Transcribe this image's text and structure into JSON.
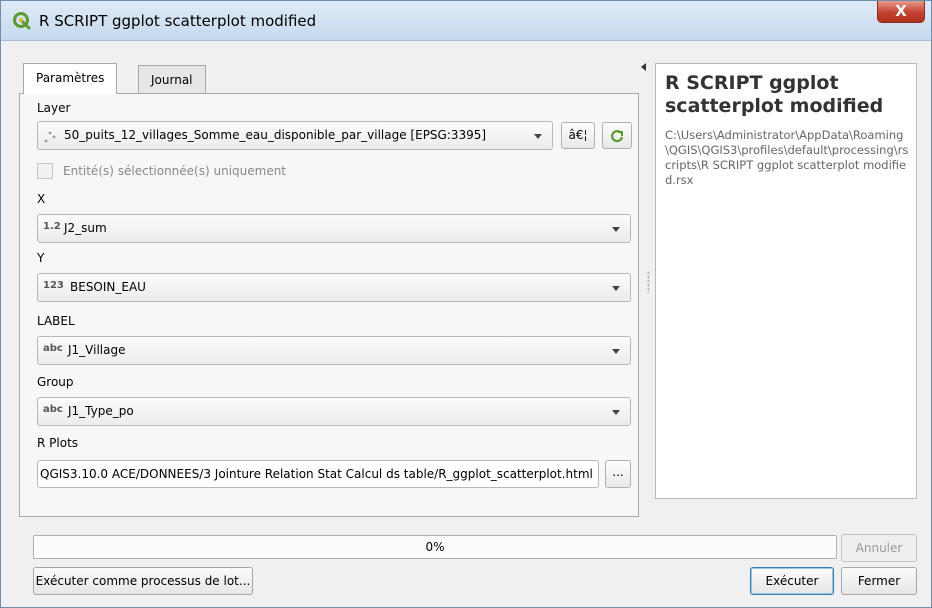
{
  "window": {
    "title": "R SCRIPT ggplot scatterplot modified",
    "close_glyph": "X"
  },
  "tabs": [
    {
      "label": "Paramètres",
      "active": true
    },
    {
      "label": "Journal",
      "active": false
    }
  ],
  "params": {
    "layer": {
      "label": "Layer",
      "value": "50_puits_12_villages_Somme_eau_disponible_par_village [EPSG:3395]",
      "icon": "point-layer-icon",
      "extra_button": "â€¦"
    },
    "selected_only": {
      "label": "Entité(s) sélectionnée(s) uniquement",
      "checked": false
    },
    "x": {
      "label": "X",
      "type_badge": "1.2",
      "value": "J2_sum"
    },
    "y": {
      "label": "Y",
      "type_badge": "123",
      "value": "BESOIN_EAU"
    },
    "label_field": {
      "label": "LABEL",
      "type_badge": "abc",
      "value": "J1_Village"
    },
    "group": {
      "label": "Group",
      "type_badge": "abc",
      "value": "J1_Type_po"
    },
    "r_plots": {
      "label": "R Plots",
      "value": "QGIS3.10.0 ACE/DONNEES/3 Jointure Relation Stat Calcul ds table/R_ggplot_scatterplot.html",
      "browse_label": "..."
    }
  },
  "help": {
    "title": "R SCRIPT ggplot scatterplot modified",
    "path": "C:\\Users\\Administrator\\AppData\\Roaming\\QGIS\\QGIS3\\profiles\\default\\processing\\rscripts\\R SCRIPT ggplot scatterplot modified.rsx"
  },
  "progress": {
    "text": "0%",
    "value": 0
  },
  "buttons": {
    "cancel": "Annuler",
    "batch": "Exécuter comme processus de lot...",
    "run": "Exécuter",
    "close": "Fermer"
  },
  "colors": {
    "qgis_green": "#5a9a2e",
    "close_red": "#c3412f",
    "accent_blue": "#3c7fb1"
  }
}
